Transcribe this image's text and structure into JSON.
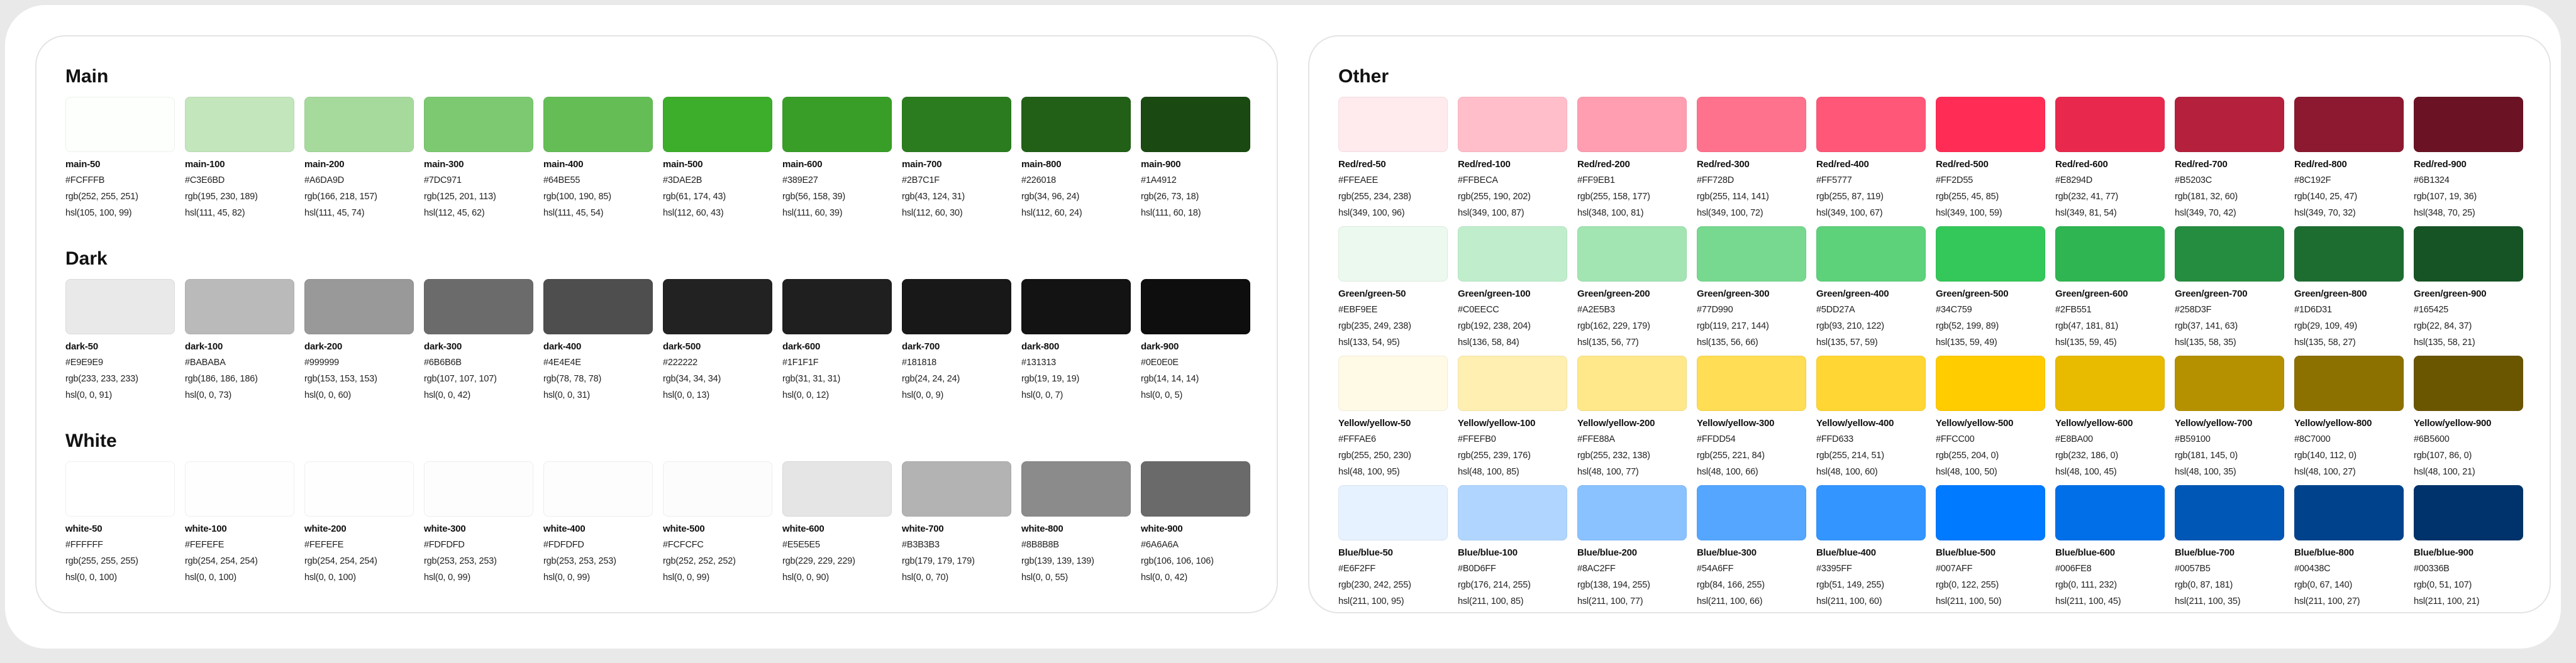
{
  "main": {
    "title": "Main",
    "swatches": [
      {
        "name": "main-50",
        "hex": "#FCFFFB",
        "rgb": "rgb(252, 255, 251)",
        "hsl": "hsl(105, 100, 99)"
      },
      {
        "name": "main-100",
        "hex": "#C3E6BD",
        "rgb": "rgb(195, 230, 189)",
        "hsl": "hsl(111, 45, 82)"
      },
      {
        "name": "main-200",
        "hex": "#A6DA9D",
        "rgb": "rgb(166, 218, 157)",
        "hsl": "hsl(111, 45, 74)"
      },
      {
        "name": "main-300",
        "hex": "#7DC971",
        "rgb": "rgb(125, 201, 113)",
        "hsl": "hsl(112, 45, 62)"
      },
      {
        "name": "main-400",
        "hex": "#64BE55",
        "rgb": "rgb(100, 190, 85)",
        "hsl": "hsl(111, 45, 54)"
      },
      {
        "name": "main-500",
        "hex": "#3DAE2B",
        "rgb": "rgb(61, 174, 43)",
        "hsl": "hsl(112, 60, 43)"
      },
      {
        "name": "main-600",
        "hex": "#389E27",
        "rgb": "rgb(56, 158, 39)",
        "hsl": "hsl(111, 60, 39)"
      },
      {
        "name": "main-700",
        "hex": "#2B7C1F",
        "rgb": "rgb(43, 124, 31)",
        "hsl": "hsl(112, 60, 30)"
      },
      {
        "name": "main-800",
        "hex": "#226018",
        "rgb": "rgb(34, 96, 24)",
        "hsl": "hsl(112, 60, 24)"
      },
      {
        "name": "main-900",
        "hex": "#1A4912",
        "rgb": "rgb(26, 73, 18)",
        "hsl": "hsl(111, 60, 18)"
      }
    ]
  },
  "dark": {
    "title": "Dark",
    "swatches": [
      {
        "name": "dark-50",
        "hex": "#E9E9E9",
        "rgb": "rgb(233, 233, 233)",
        "hsl": "hsl(0, 0, 91)"
      },
      {
        "name": "dark-100",
        "hex": "#BABABA",
        "rgb": "rgb(186, 186, 186)",
        "hsl": "hsl(0, 0, 73)"
      },
      {
        "name": "dark-200",
        "hex": "#999999",
        "rgb": "rgb(153, 153, 153)",
        "hsl": "hsl(0, 0, 60)"
      },
      {
        "name": "dark-300",
        "hex": "#6B6B6B",
        "rgb": "rgb(107, 107, 107)",
        "hsl": "hsl(0, 0, 42)"
      },
      {
        "name": "dark-400",
        "hex": "#4E4E4E",
        "rgb": "rgb(78, 78, 78)",
        "hsl": "hsl(0, 0, 31)"
      },
      {
        "name": "dark-500",
        "hex": "#222222",
        "rgb": "rgb(34, 34, 34)",
        "hsl": "hsl(0, 0, 13)"
      },
      {
        "name": "dark-600",
        "hex": "#1F1F1F",
        "rgb": "rgb(31, 31, 31)",
        "hsl": "hsl(0, 0, 12)"
      },
      {
        "name": "dark-700",
        "hex": "#181818",
        "rgb": "rgb(24, 24, 24)",
        "hsl": "hsl(0, 0, 9)"
      },
      {
        "name": "dark-800",
        "hex": "#131313",
        "rgb": "rgb(19, 19, 19)",
        "hsl": "hsl(0, 0, 7)"
      },
      {
        "name": "dark-900",
        "hex": "#0E0E0E",
        "rgb": "rgb(14, 14, 14)",
        "hsl": "hsl(0, 0, 5)"
      }
    ]
  },
  "white": {
    "title": "White",
    "swatches": [
      {
        "name": "white-50",
        "hex": "#FFFFFF",
        "rgb": "rgb(255, 255, 255)",
        "hsl": "hsl(0, 0, 100)"
      },
      {
        "name": "white-100",
        "hex": "#FEFEFE",
        "rgb": "rgb(254, 254, 254)",
        "hsl": "hsl(0, 0, 100)"
      },
      {
        "name": "white-200",
        "hex": "#FEFEFE",
        "rgb": "rgb(254, 254, 254)",
        "hsl": "hsl(0, 0, 100)"
      },
      {
        "name": "white-300",
        "hex": "#FDFDFD",
        "rgb": "rgb(253, 253, 253)",
        "hsl": "hsl(0, 0, 99)"
      },
      {
        "name": "white-400",
        "hex": "#FDFDFD",
        "rgb": "rgb(253, 253, 253)",
        "hsl": "hsl(0, 0, 99)"
      },
      {
        "name": "white-500",
        "hex": "#FCFCFC",
        "rgb": "rgb(252, 252, 252)",
        "hsl": "hsl(0, 0, 99)"
      },
      {
        "name": "white-600",
        "hex": "#E5E5E5",
        "rgb": "rgb(229, 229, 229)",
        "hsl": "hsl(0, 0, 90)"
      },
      {
        "name": "white-700",
        "hex": "#B3B3B3",
        "rgb": "rgb(179, 179, 179)",
        "hsl": "hsl(0, 0, 70)"
      },
      {
        "name": "white-800",
        "hex": "#8B8B8B",
        "rgb": "rgb(139, 139, 139)",
        "hsl": "hsl(0, 0, 55)"
      },
      {
        "name": "white-900",
        "hex": "#6A6A6A",
        "rgb": "rgb(106, 106, 106)",
        "hsl": "hsl(0, 0, 42)"
      }
    ]
  },
  "other": {
    "title": "Other",
    "groups": [
      {
        "key": "red",
        "swatches": [
          {
            "name": "Red/red-50",
            "hex": "#FFEAEE",
            "rgb": "rgb(255, 234, 238)",
            "hsl": "hsl(349, 100, 96)"
          },
          {
            "name": "Red/red-100",
            "hex": "#FFBECA",
            "rgb": "rgb(255, 190, 202)",
            "hsl": "hsl(349, 100, 87)"
          },
          {
            "name": "Red/red-200",
            "hex": "#FF9EB1",
            "rgb": "rgb(255, 158, 177)",
            "hsl": "hsl(348, 100, 81)"
          },
          {
            "name": "Red/red-300",
            "hex": "#FF728D",
            "rgb": "rgb(255, 114, 141)",
            "hsl": "hsl(349, 100, 72)"
          },
          {
            "name": "Red/red-400",
            "hex": "#FF5777",
            "rgb": "rgb(255, 87, 119)",
            "hsl": "hsl(349, 100, 67)"
          },
          {
            "name": "Red/red-500",
            "hex": "#FF2D55",
            "rgb": "rgb(255, 45, 85)",
            "hsl": "hsl(349, 100, 59)"
          },
          {
            "name": "Red/red-600",
            "hex": "#E8294D",
            "rgb": "rgb(232, 41, 77)",
            "hsl": "hsl(349, 81, 54)"
          },
          {
            "name": "Red/red-700",
            "hex": "#B5203C",
            "rgb": "rgb(181, 32, 60)",
            "hsl": "hsl(349, 70, 42)"
          },
          {
            "name": "Red/red-800",
            "hex": "#8C192F",
            "rgb": "rgb(140, 25, 47)",
            "hsl": "hsl(349, 70, 32)"
          },
          {
            "name": "Red/red-900",
            "hex": "#6B1324",
            "rgb": "rgb(107, 19, 36)",
            "hsl": "hsl(348, 70, 25)"
          }
        ]
      },
      {
        "key": "green",
        "swatches": [
          {
            "name": "Green/green-50",
            "hex": "#EBF9EE",
            "rgb": "rgb(235, 249, 238)",
            "hsl": "hsl(133, 54, 95)"
          },
          {
            "name": "Green/green-100",
            "hex": "#C0EECC",
            "rgb": "rgb(192, 238, 204)",
            "hsl": "hsl(136, 58, 84)"
          },
          {
            "name": "Green/green-200",
            "hex": "#A2E5B3",
            "rgb": "rgb(162, 229, 179)",
            "hsl": "hsl(135, 56, 77)"
          },
          {
            "name": "Green/green-300",
            "hex": "#77D990",
            "rgb": "rgb(119, 217, 144)",
            "hsl": "hsl(135, 56, 66)"
          },
          {
            "name": "Green/green-400",
            "hex": "#5DD27A",
            "rgb": "rgb(93, 210, 122)",
            "hsl": "hsl(135, 57, 59)"
          },
          {
            "name": "Green/green-500",
            "hex": "#34C759",
            "rgb": "rgb(52, 199, 89)",
            "hsl": "hsl(135, 59, 49)"
          },
          {
            "name": "Green/green-600",
            "hex": "#2FB551",
            "rgb": "rgb(47, 181, 81)",
            "hsl": "hsl(135, 59, 45)"
          },
          {
            "name": "Green/green-700",
            "hex": "#258D3F",
            "rgb": "rgb(37, 141, 63)",
            "hsl": "hsl(135, 58, 35)"
          },
          {
            "name": "Green/green-800",
            "hex": "#1D6D31",
            "rgb": "rgb(29, 109, 49)",
            "hsl": "hsl(135, 58, 27)"
          },
          {
            "name": "Green/green-900",
            "hex": "#165425",
            "rgb": "rgb(22, 84, 37)",
            "hsl": "hsl(135, 58, 21)"
          }
        ]
      },
      {
        "key": "yellow",
        "swatches": [
          {
            "name": "Yellow/yellow-50",
            "hex": "#FFFAE6",
            "rgb": "rgb(255, 250, 230)",
            "hsl": "hsl(48, 100, 95)"
          },
          {
            "name": "Yellow/yellow-100",
            "hex": "#FFEFB0",
            "rgb": "rgb(255, 239, 176)",
            "hsl": "hsl(48, 100, 85)"
          },
          {
            "name": "Yellow/yellow-200",
            "hex": "#FFE88A",
            "rgb": "rgb(255, 232, 138)",
            "hsl": "hsl(48, 100, 77)"
          },
          {
            "name": "Yellow/yellow-300",
            "hex": "#FFDD54",
            "rgb": "rgb(255, 221, 84)",
            "hsl": "hsl(48, 100, 66)"
          },
          {
            "name": "Yellow/yellow-400",
            "hex": "#FFD633",
            "rgb": "rgb(255, 214, 51)",
            "hsl": "hsl(48, 100, 60)"
          },
          {
            "name": "Yellow/yellow-500",
            "hex": "#FFCC00",
            "rgb": "rgb(255, 204, 0)",
            "hsl": "hsl(48, 100, 50)"
          },
          {
            "name": "Yellow/yellow-600",
            "hex": "#E8BA00",
            "rgb": "rgb(232, 186, 0)",
            "hsl": "hsl(48, 100, 45)"
          },
          {
            "name": "Yellow/yellow-700",
            "hex": "#B59100",
            "rgb": "rgb(181, 145, 0)",
            "hsl": "hsl(48, 100, 35)"
          },
          {
            "name": "Yellow/yellow-800",
            "hex": "#8C7000",
            "rgb": "rgb(140, 112, 0)",
            "hsl": "hsl(48, 100, 27)"
          },
          {
            "name": "Yellow/yellow-900",
            "hex": "#6B5600",
            "rgb": "rgb(107, 86, 0)",
            "hsl": "hsl(48, 100, 21)"
          }
        ]
      },
      {
        "key": "blue",
        "swatches": [
          {
            "name": "Blue/blue-50",
            "hex": "#E6F2FF",
            "rgb": "rgb(230, 242, 255)",
            "hsl": "hsl(211, 100, 95)"
          },
          {
            "name": "Blue/blue-100",
            "hex": "#B0D6FF",
            "rgb": "rgb(176, 214, 255)",
            "hsl": "hsl(211, 100, 85)"
          },
          {
            "name": "Blue/blue-200",
            "hex": "#8AC2FF",
            "rgb": "rgb(138, 194, 255)",
            "hsl": "hsl(211, 100, 77)"
          },
          {
            "name": "Blue/blue-300",
            "hex": "#54A6FF",
            "rgb": "rgb(84, 166, 255)",
            "hsl": "hsl(211, 100, 66)"
          },
          {
            "name": "Blue/blue-400",
            "hex": "#3395FF",
            "rgb": "rgb(51, 149, 255)",
            "hsl": "hsl(211, 100, 60)"
          },
          {
            "name": "Blue/blue-500",
            "hex": "#007AFF",
            "rgb": "rgb(0, 122, 255)",
            "hsl": "hsl(211, 100, 50)"
          },
          {
            "name": "Blue/blue-600",
            "hex": "#006FE8",
            "rgb": "rgb(0, 111, 232)",
            "hsl": "hsl(211, 100, 45)"
          },
          {
            "name": "Blue/blue-700",
            "hex": "#0057B5",
            "rgb": "rgb(0, 87, 181)",
            "hsl": "hsl(211, 100, 35)"
          },
          {
            "name": "Blue/blue-800",
            "hex": "#00438C",
            "rgb": "rgb(0, 67, 140)",
            "hsl": "hsl(211, 100, 27)"
          },
          {
            "name": "Blue/blue-900",
            "hex": "#00336B",
            "rgb": "rgb(0, 51, 107)",
            "hsl": "hsl(211, 100, 21)"
          }
        ]
      }
    ]
  }
}
